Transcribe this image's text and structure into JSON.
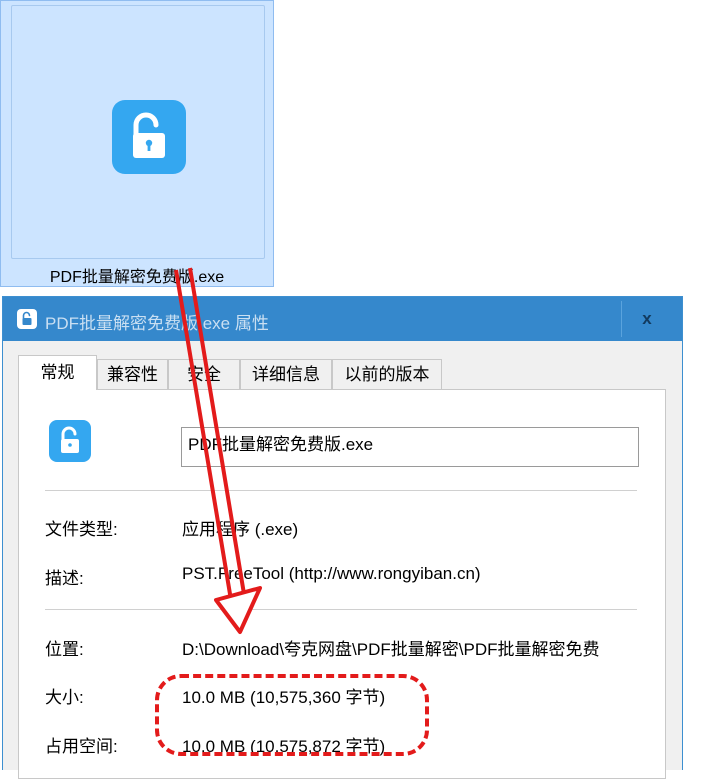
{
  "file_icon": {
    "name": "PDF批量解密免费版.exe"
  },
  "dialog": {
    "title": "PDF批量解密免费版.exe 属性",
    "close_label": "x",
    "tabs": [
      {
        "label": "常规",
        "active": true
      },
      {
        "label": "兼容性",
        "active": false
      },
      {
        "label": "安全",
        "active": false
      },
      {
        "label": "详细信息",
        "active": false
      },
      {
        "label": "以前的版本",
        "active": false
      }
    ],
    "file_name_value": "PDF批量解密免费版.exe",
    "properties": [
      {
        "label": "文件类型:",
        "value": "应用程序 (.exe)"
      },
      {
        "label": "描述:",
        "value": "PST.FreeTool (http://www.rongyiban.cn)"
      },
      {
        "label": "位置:",
        "value": "D:\\Download\\夸克网盘\\PDF批量解密\\PDF批量解密免费"
      },
      {
        "label": "大小:",
        "value": "10.0 MB (10,575,360 字节)"
      },
      {
        "label": "占用空间:",
        "value": "10.0 MB (10,575,872 字节)"
      }
    ]
  },
  "colors": {
    "accent": "#3588cc",
    "icon": "#34a7f0",
    "annotation": "#e31b1b",
    "selection": "#cce4ff"
  },
  "icons": [
    "unlocked-padlock-icon",
    "close-icon"
  ]
}
